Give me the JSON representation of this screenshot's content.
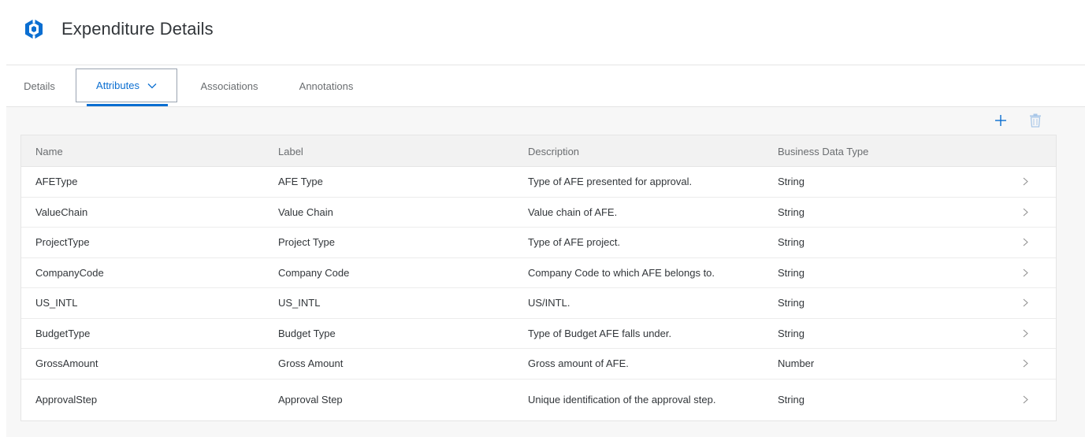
{
  "header": {
    "title": "Expenditure Details",
    "icon": "data-model-icon",
    "icon_color": "#0a6ed1"
  },
  "tabs": [
    {
      "label": "Details",
      "selected": false
    },
    {
      "label": "Attributes",
      "selected": true,
      "has_menu": true
    },
    {
      "label": "Associations",
      "selected": false
    },
    {
      "label": "Annotations",
      "selected": false
    }
  ],
  "toolbar": {
    "add_icon": "plus-icon",
    "delete_icon": "trash-icon"
  },
  "table": {
    "columns": [
      "Name",
      "Label",
      "Description",
      "Business Data Type"
    ],
    "rows": [
      {
        "name": "AFEType",
        "label": "AFE Type",
        "description": "Type of AFE presented for approval.",
        "type": "String"
      },
      {
        "name": "ValueChain",
        "label": "Value Chain",
        "description": "Value chain of AFE.",
        "type": "String"
      },
      {
        "name": "ProjectType",
        "label": "Project Type",
        "description": "Type of AFE project.",
        "type": "String"
      },
      {
        "name": "CompanyCode",
        "label": "Company Code",
        "description": "Company Code to which AFE belongs to.",
        "type": "String"
      },
      {
        "name": "US_INTL",
        "label": "US_INTL",
        "description": "US/INTL.",
        "type": "String"
      },
      {
        "name": "BudgetType",
        "label": "Budget Type",
        "description": "Type of Budget AFE falls under.",
        "type": "String"
      },
      {
        "name": "GrossAmount",
        "label": "Gross Amount",
        "description": "Gross amount of AFE.",
        "type": "Number"
      },
      {
        "name": "ApprovalStep",
        "label": "Approval Step",
        "description": "Unique identification of the approval step.",
        "type": "String"
      }
    ]
  },
  "colors": {
    "accent": "#0a6ed1",
    "text": "#32363a",
    "muted": "#6a6d70",
    "content_bg": "#f7f7f7",
    "header_row_bg": "#f2f2f2"
  }
}
